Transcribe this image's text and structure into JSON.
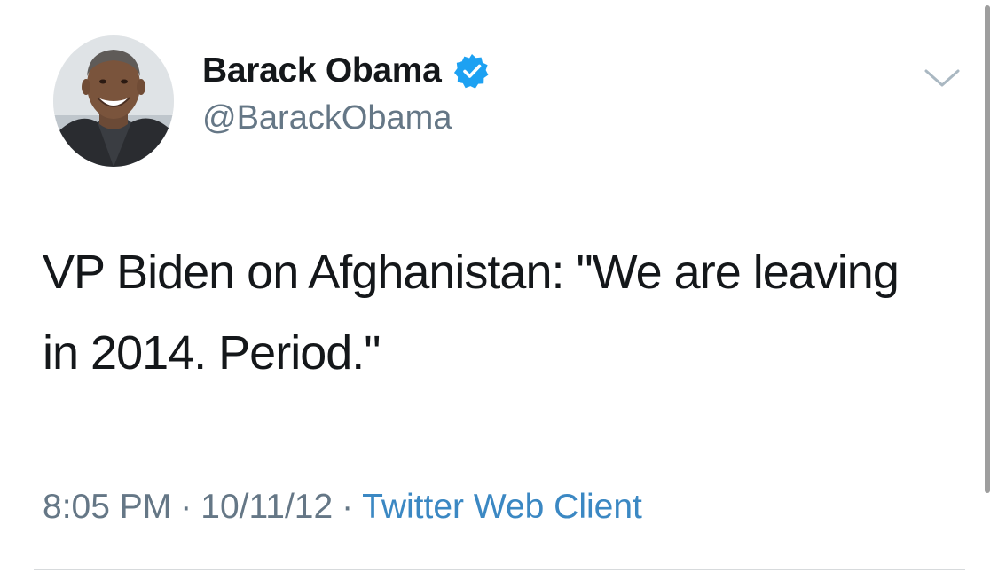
{
  "user": {
    "display_name": "Barack Obama",
    "handle": "@BarackObama",
    "verified": true,
    "avatar": "profile-photo"
  },
  "tweet": {
    "text": "VP Biden on Afghanistan: \"We are leaving in 2014. Period.\"",
    "time": "8:05 PM",
    "separator": "·",
    "date": "10/11/12",
    "source": "Twitter Web Client"
  },
  "icons": {
    "verified": "verified-badge-icon",
    "more": "chevron-down-icon"
  },
  "colors": {
    "verified_blue": "#1da1f2",
    "link_blue": "#3b88c3",
    "secondary_text": "#657786",
    "primary_text": "#14171a"
  }
}
